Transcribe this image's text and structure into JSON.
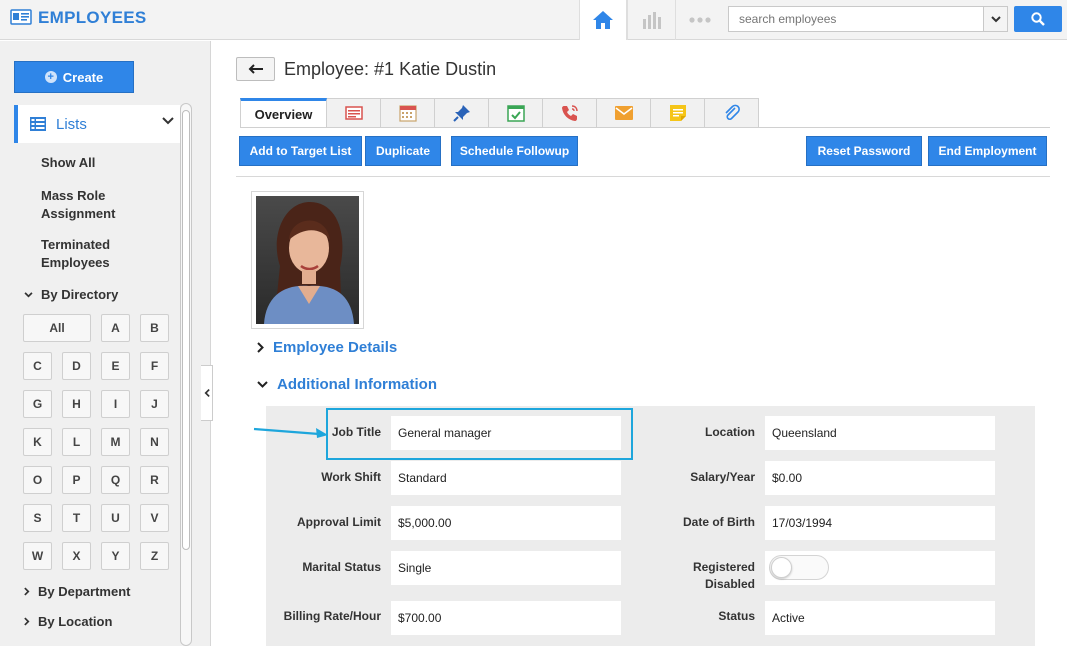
{
  "header": {
    "app_title": "EMPLOYEES",
    "search_placeholder": "search employees"
  },
  "sidebar": {
    "create_label": "Create",
    "lists_label": "Lists",
    "links": [
      "Show All",
      "Mass Role\nAssignment",
      "Terminated\nEmployees"
    ],
    "show_all": "Show All",
    "mass_role_1": "Mass Role",
    "mass_role_2": "Assignment",
    "terminated_1": "Terminated",
    "terminated_2": "Employees",
    "by_directory": "By Directory",
    "letters": [
      "All",
      "A",
      "B",
      "C",
      "D",
      "E",
      "F",
      "G",
      "H",
      "I",
      "J",
      "K",
      "L",
      "M",
      "N",
      "O",
      "P",
      "Q",
      "R",
      "S",
      "T",
      "U",
      "V",
      "W",
      "X",
      "Y",
      "Z"
    ],
    "by_department": "By Department",
    "by_location": "By Location"
  },
  "main": {
    "title": "Employee: #1 Katie Dustin",
    "tabs": {
      "overview": "Overview"
    },
    "actions": {
      "add_to_target_list": "Add to Target List",
      "duplicate": "Duplicate",
      "schedule_followup": "Schedule Followup",
      "reset_password": "Reset Password",
      "end_employment": "End Employment"
    },
    "sections": {
      "employee_details": "Employee Details",
      "additional_information": "Additional Information"
    },
    "fields": {
      "job_title": {
        "label": "Job Title",
        "value": "General manager"
      },
      "location": {
        "label": "Location",
        "value": "Queensland"
      },
      "work_shift": {
        "label": "Work Shift",
        "value": "Standard"
      },
      "salary_year": {
        "label": "Salary/Year",
        "value": "$0.00"
      },
      "approval_limit": {
        "label": "Approval Limit",
        "value": "$5,000.00"
      },
      "date_of_birth": {
        "label": "Date of Birth",
        "value": "17/03/1994"
      },
      "marital_status": {
        "label": "Marital Status",
        "value": "Single"
      },
      "registered_disabled": {
        "label_1": "Registered",
        "label_2": "Disabled",
        "value": false
      },
      "billing_rate": {
        "label": "Billing Rate/Hour",
        "value": "$700.00"
      },
      "status": {
        "label": "Status",
        "value": "Active"
      }
    }
  },
  "colors": {
    "accent": "#2f86e8",
    "title_blue": "#2f7fd6",
    "highlight": "#1ea6dc"
  }
}
